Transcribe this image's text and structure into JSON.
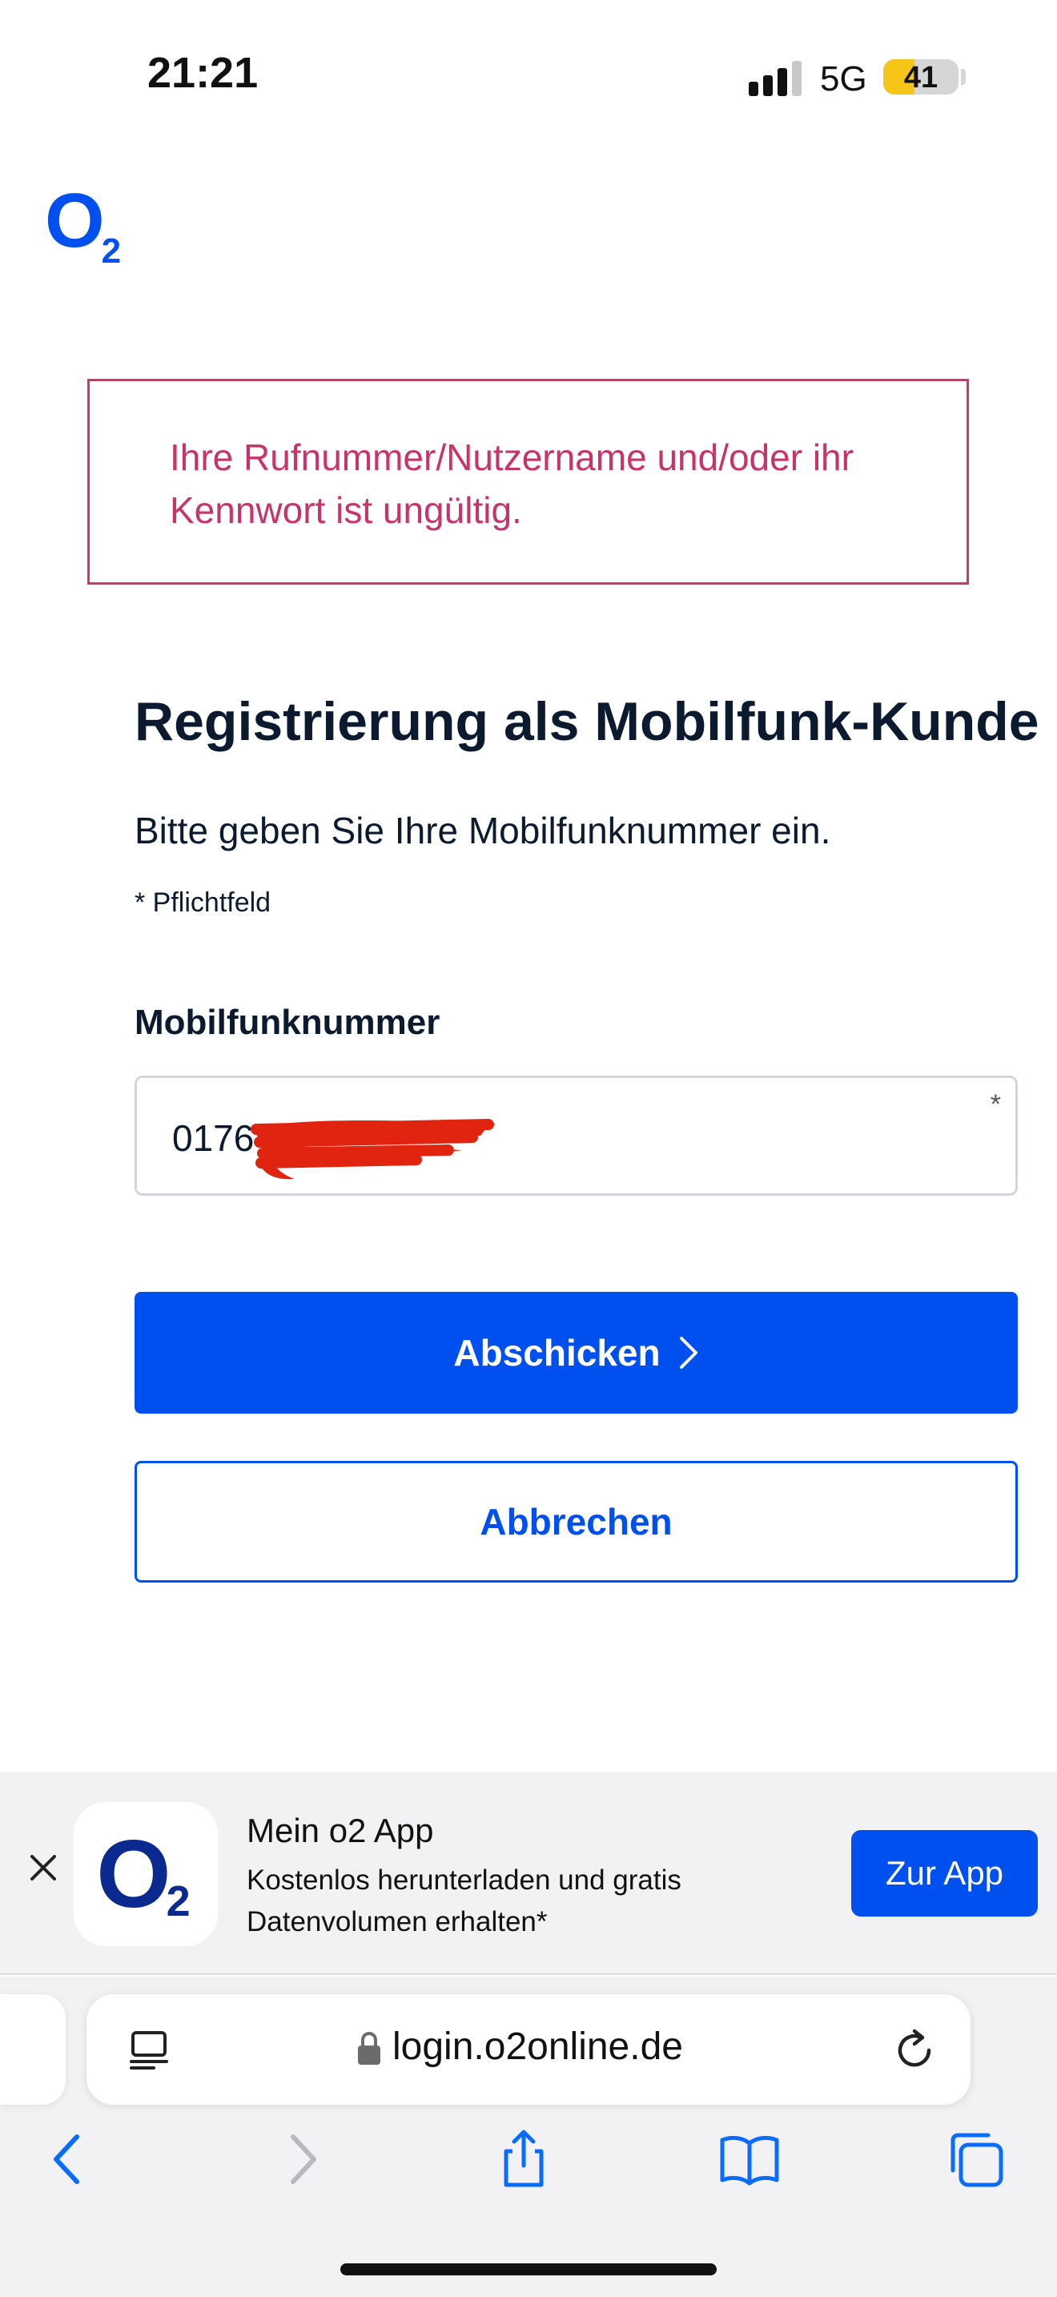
{
  "status_bar": {
    "time": "21:21",
    "network": "5G",
    "battery_percent": "41",
    "battery_level": 0.41,
    "battery_color": "#f5c518",
    "signal_bars_active": 3,
    "signal_bars_total": 4
  },
  "brand": {
    "logo_main": "O",
    "logo_sub": "2",
    "accent_color": "#0050f0"
  },
  "error": {
    "message": "Ihre Rufnummer/Nutzername und/oder ihr Kennwort ist ungültig.",
    "color": "#c7336a"
  },
  "form": {
    "title": "Registrierung als Mobilfunk-Kunde",
    "subtitle": "Bitte geben Sie Ihre Mobilfunknummer ein.",
    "required_hint": "* Pflichtfeld",
    "field_label": "Mobilfunknummer",
    "field_value": "0176",
    "required_marker": "*",
    "submit_label": "Abschicken",
    "submit_icon": "chevron-right-icon",
    "cancel_label": "Abbrechen"
  },
  "app_banner": {
    "close_icon": "close-icon",
    "icon_main": "O",
    "icon_sub": "2",
    "title": "Mein o2 App",
    "description": "Kostenlos herunterladen und gratis Datenvolumen erhalten*",
    "open_label": "Zur App"
  },
  "browser": {
    "url": "login.o2online.de",
    "icons": [
      "reader-icon",
      "lock-icon",
      "reload-icon",
      "back-icon",
      "forward-icon",
      "share-icon",
      "bookmarks-icon",
      "tabs-icon"
    ]
  }
}
